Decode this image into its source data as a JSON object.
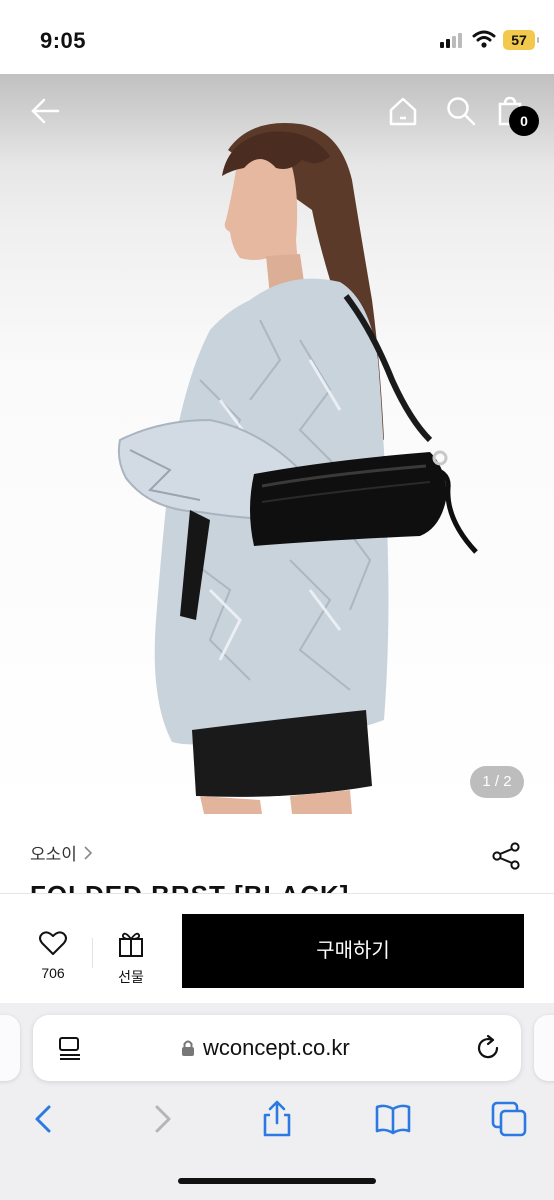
{
  "status_bar": {
    "time": "9:05",
    "battery": "57"
  },
  "header": {
    "back_icon": "back-arrow-icon",
    "home_icon": "home-icon",
    "search_icon": "search-icon",
    "cart_icon": "shopping-bag-icon",
    "cart_count": "0"
  },
  "gallery": {
    "pager": "1 / 2"
  },
  "product": {
    "brand": "오소이",
    "title": "FOLDED BRST [BLACK]"
  },
  "actions": {
    "like_count": "706",
    "gift_label": "선물",
    "buy_label": "구매하기"
  },
  "browser": {
    "url": "wconcept.co.kr"
  },
  "colors": {
    "accent": "#000000",
    "link_blue": "#2a7ae2",
    "battery": "#f2c94c"
  }
}
